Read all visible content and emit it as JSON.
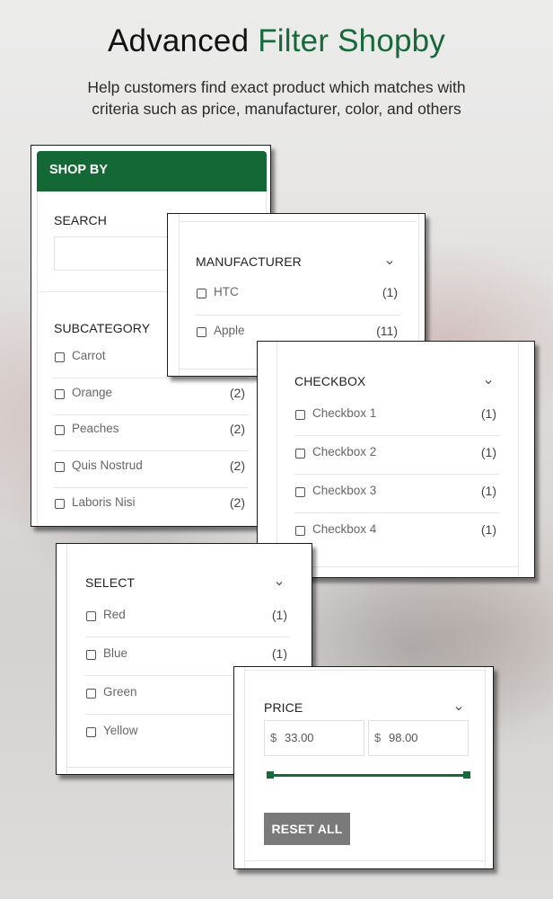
{
  "hero": {
    "title_part1": "Advanced",
    "title_part2": "Filter Shopby",
    "subtitle_line1": "Help customers find exact product which matches with",
    "subtitle_line2": "criteria such as price, manufacturer, color, and others"
  },
  "colors": {
    "brand_green": "#136836",
    "reset_button": "#7a7a7a"
  },
  "shop_by": {
    "header": "SHOP BY",
    "search_label": "SEARCH",
    "search_value": "",
    "subcategory_label": "SUBCATEGORY",
    "subcategory_items": [
      {
        "label": "Carrot",
        "count": ""
      },
      {
        "label": "Orange",
        "count": "(2)"
      },
      {
        "label": "Peaches",
        "count": "(2)"
      },
      {
        "label": "Quis Nostrud",
        "count": "(2)"
      },
      {
        "label": "Laboris Nisi",
        "count": "(2)"
      }
    ]
  },
  "manufacturer": {
    "title": "MANUFACTURER",
    "items": [
      {
        "label": "HTC",
        "count": "(1)"
      },
      {
        "label": "Apple",
        "count": "(11)"
      }
    ]
  },
  "checkbox": {
    "title": "CHECKBOX",
    "items": [
      {
        "label": "Checkbox 1",
        "count": "(1)"
      },
      {
        "label": "Checkbox 2",
        "count": "(1)"
      },
      {
        "label": "Checkbox 3",
        "count": "(1)"
      },
      {
        "label": "Checkbox 4",
        "count": "(1)"
      }
    ]
  },
  "select": {
    "title": "SELECT",
    "items": [
      {
        "label": "Red",
        "count": "(1)"
      },
      {
        "label": "Blue",
        "count": "(1)"
      },
      {
        "label": "Green",
        "count": ""
      },
      {
        "label": "Yellow",
        "count": ""
      }
    ]
  },
  "price": {
    "title": "PRICE",
    "currency": "$",
    "min_value": "33.00",
    "max_value": "98.00",
    "reset_label": "RESET ALL"
  }
}
